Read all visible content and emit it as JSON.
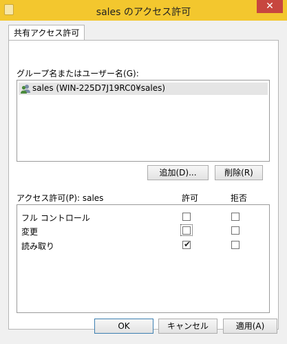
{
  "window": {
    "title": "sales のアクセス許可",
    "close_glyph": "✕"
  },
  "tab": {
    "label": "共有アクセス許可"
  },
  "group_section": {
    "label": "グループ名またはユーザー名(G):",
    "items": [
      {
        "label": "sales (WIN-225D7J19RC0¥sales)",
        "icon": "users-group-icon",
        "selected": true
      }
    ]
  },
  "buttons": {
    "add": "追加(D)...",
    "remove": "削除(R)"
  },
  "permissions": {
    "label": "アクセス許可(P): sales",
    "allow_header": "許可",
    "deny_header": "拒否",
    "rows": [
      {
        "label": "フル コントロール",
        "allow": false,
        "deny": false
      },
      {
        "label": "変更",
        "allow": false,
        "deny": false
      },
      {
        "label": "読み取り",
        "allow": true,
        "deny": false
      }
    ]
  },
  "footer": {
    "ok": "OK",
    "cancel": "キャンセル",
    "apply": "適用(A)"
  },
  "colors": {
    "titlebar": "#f3c72e",
    "close": "#c7463f",
    "selection": "#e5e5e5"
  }
}
